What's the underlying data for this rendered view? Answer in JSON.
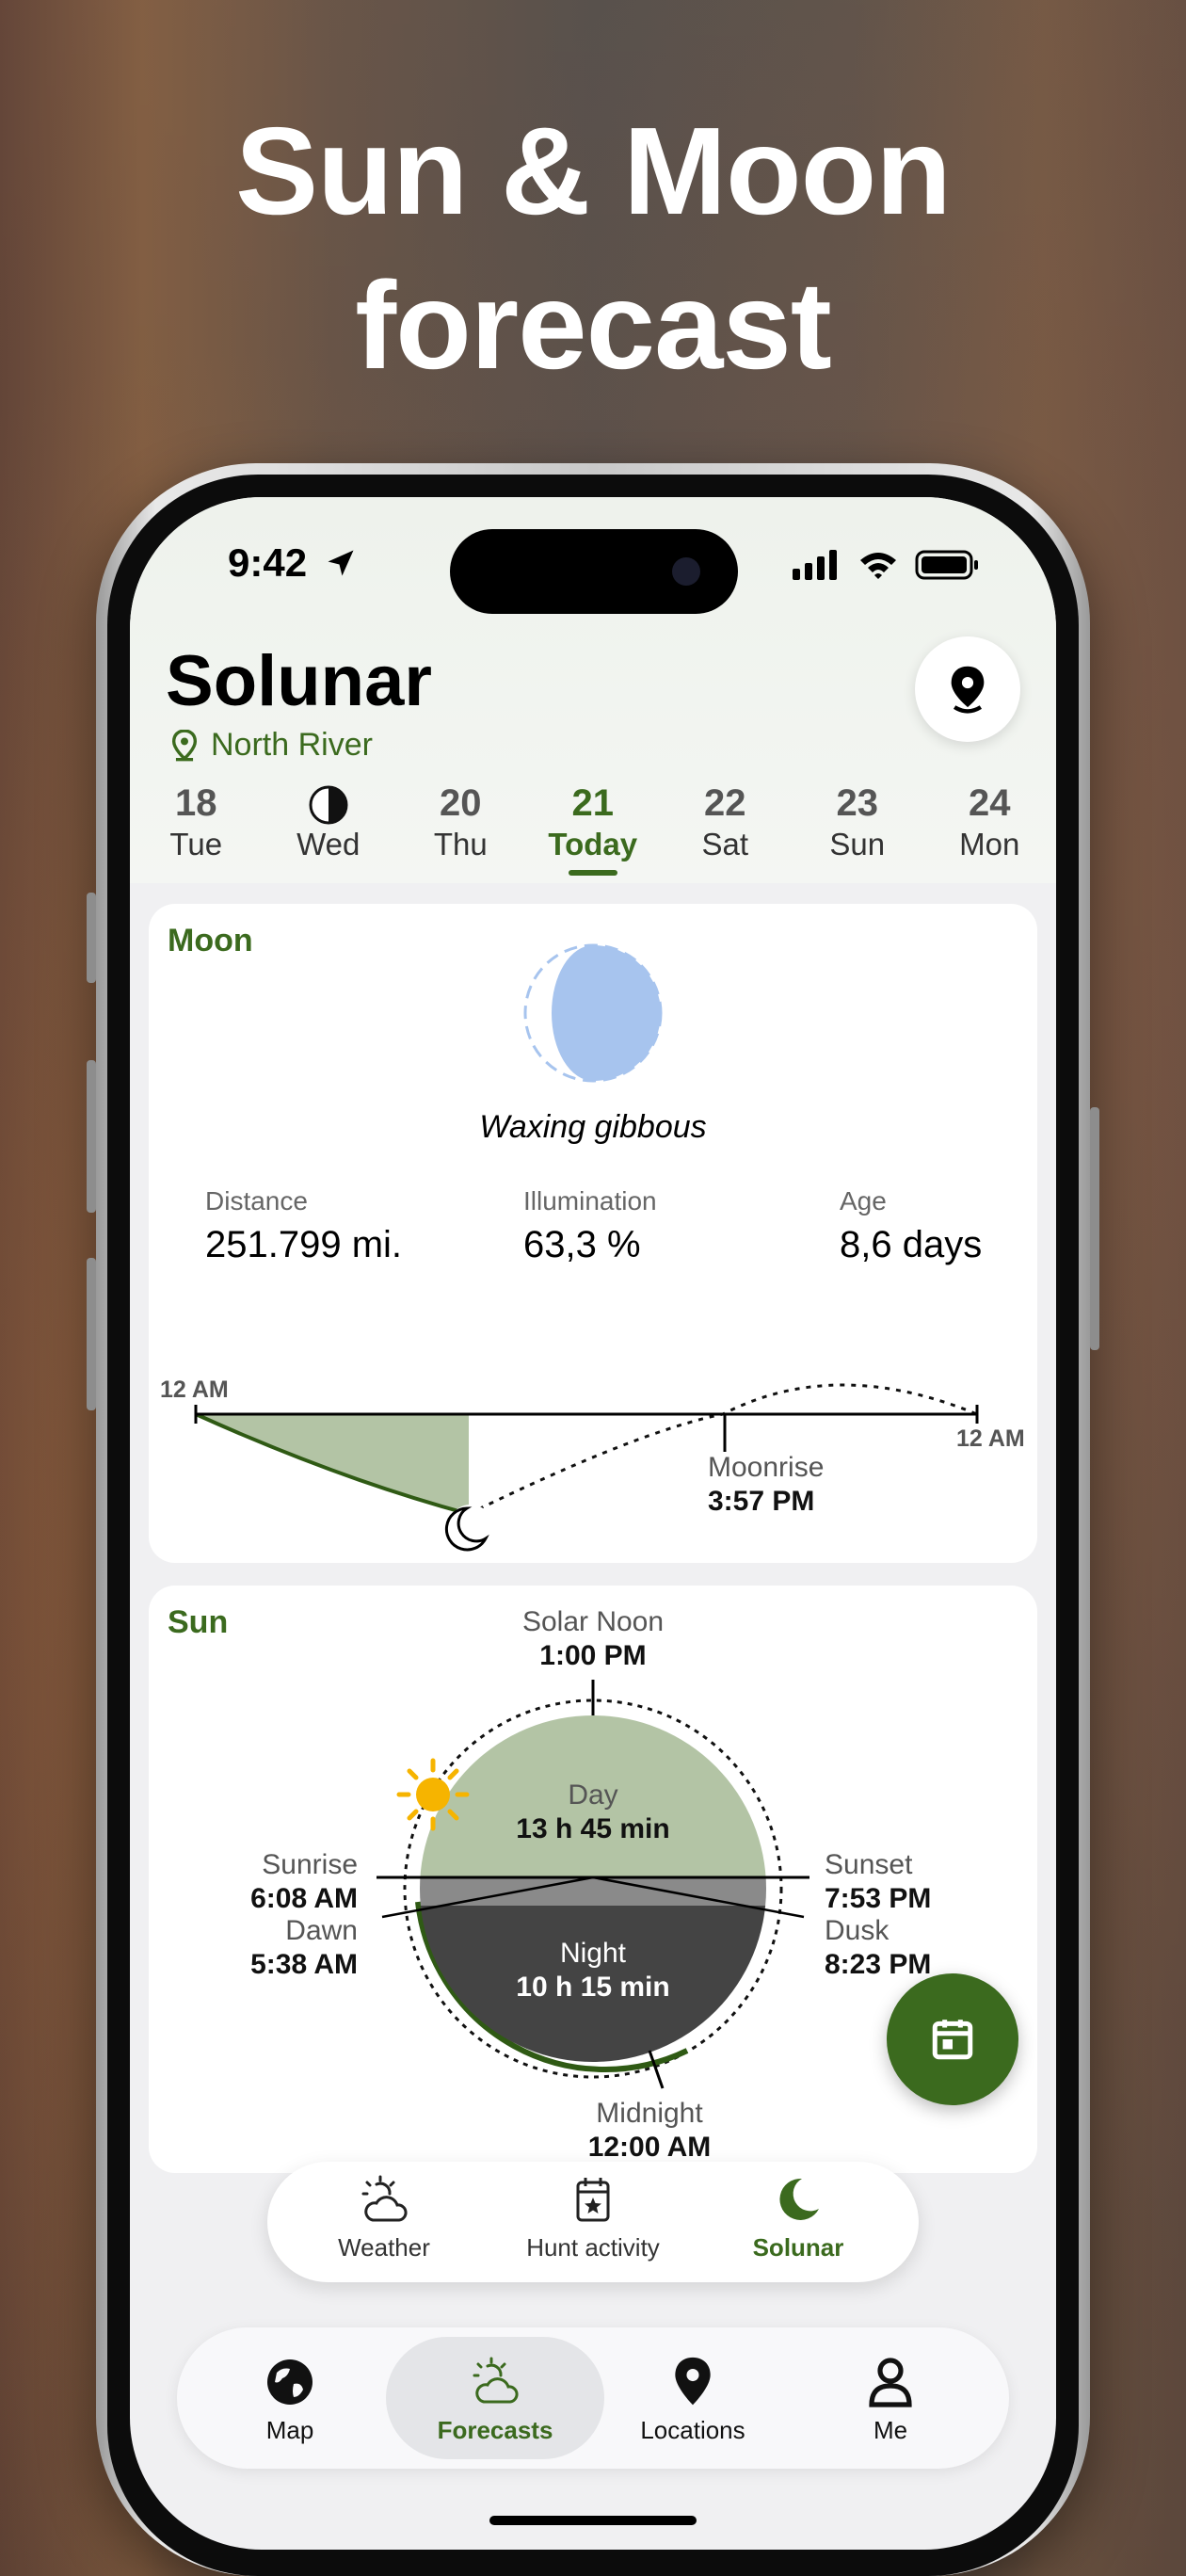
{
  "promo": {
    "line1": "Sun & Moon",
    "line2": "forecast"
  },
  "status_bar": {
    "time": "9:42"
  },
  "app": {
    "title": "Solunar",
    "location": "North River"
  },
  "days": [
    {
      "num": "18",
      "label": "Tue",
      "active": false
    },
    {
      "num": "",
      "label": "Wed",
      "active": false,
      "icon": "half-moon-icon"
    },
    {
      "num": "20",
      "label": "Thu",
      "active": false
    },
    {
      "num": "21",
      "label": "Today",
      "active": true
    },
    {
      "num": "22",
      "label": "Sat",
      "active": false
    },
    {
      "num": "23",
      "label": "Sun",
      "active": false
    },
    {
      "num": "24",
      "label": "Mon",
      "active": false
    }
  ],
  "moon": {
    "title": "Moon",
    "phase": "Waxing gibbous",
    "stats": [
      {
        "label": "Distance",
        "value": "251.799 mi."
      },
      {
        "label": "Illumination",
        "value": "63,3 %"
      },
      {
        "label": "Age",
        "value": "8,6 days"
      }
    ],
    "chart": {
      "start_label": "12 AM",
      "end_label": "12 AM",
      "moonrise_label": "Moonrise",
      "moonrise_time": "3:57 PM"
    }
  },
  "sun": {
    "title": "Sun",
    "solar_noon_label": "Solar Noon",
    "solar_noon_time": "1:00 PM",
    "day_label": "Day",
    "day_length": "13 h 45 min",
    "night_label": "Night",
    "night_length": "10 h 15 min",
    "sunrise_label": "Sunrise",
    "sunrise_time": "6:08 AM",
    "dawn_label": "Dawn",
    "dawn_time": "5:38 AM",
    "sunset_label": "Sunset",
    "sunset_time": "7:53 PM",
    "dusk_label": "Dusk",
    "dusk_time": "8:23 PM",
    "midnight_label": "Midnight",
    "midnight_time": "12:00 AM"
  },
  "subnav": [
    {
      "label": "Weather",
      "icon": "partly-cloudy-icon",
      "active": false
    },
    {
      "label": "Hunt activity",
      "icon": "calendar-star-icon",
      "active": false
    },
    {
      "label": "Solunar",
      "icon": "crescent-moon-icon",
      "active": true
    }
  ],
  "tabbar": [
    {
      "label": "Map",
      "icon": "globe-icon",
      "active": false
    },
    {
      "label": "Forecasts",
      "icon": "partly-cloudy-icon",
      "active": true
    },
    {
      "label": "Locations",
      "icon": "map-pin-icon",
      "active": false
    },
    {
      "label": "Me",
      "icon": "person-icon",
      "active": false
    }
  ],
  "colors": {
    "accent": "#3b6a1e",
    "moon_fill": "#a7c4ee",
    "day_fill": "#b3c4a5",
    "night_fill": "#444444",
    "sun": "#f6b400"
  }
}
